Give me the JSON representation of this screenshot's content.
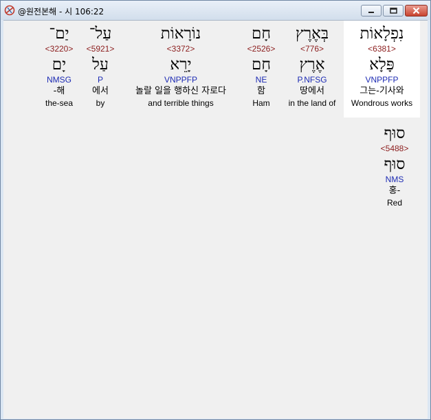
{
  "window": {
    "title": "@원전본해 - 시 106:22"
  },
  "words": [
    {
      "hebrew": "יַם־",
      "strong": "<3220>",
      "lemma": "יָם",
      "morph": "NMSG",
      "korean": "-해",
      "english": "the-sea"
    },
    {
      "hebrew": "עַל־",
      "strong": "<5921>",
      "lemma": "עַל",
      "morph": "P",
      "korean": "에서",
      "english": "by"
    },
    {
      "hebrew": "נוֹרָאוֹת",
      "strong": "<3372>",
      "lemma": "יָרֵא",
      "morph": "VNPPFP",
      "korean": "놀랄 일을 행하신 자로다",
      "english": "and terrible things"
    },
    {
      "hebrew": "חָם",
      "strong": "<2526>",
      "lemma": "חָם",
      "morph": "NE",
      "korean": "함",
      "english": "Ham"
    },
    {
      "hebrew": "בְּאֶרֶץ",
      "strong": "<776>",
      "lemma": "אֶרֶץ",
      "morph": "P.NFSG",
      "korean": "땅에서",
      "english": "in the land of"
    },
    {
      "hebrew": "נִפְלָאוֹת",
      "strong": "<6381>",
      "lemma": "פָּלָא",
      "morph": "VNPPFP",
      "korean": "그는-기사와",
      "english": "Wondrous works"
    },
    {
      "hebrew": "סוּף",
      "strong": "<5488>",
      "lemma": "סוּף",
      "morph": "NMS",
      "korean": "홍-",
      "english": "Red"
    }
  ]
}
